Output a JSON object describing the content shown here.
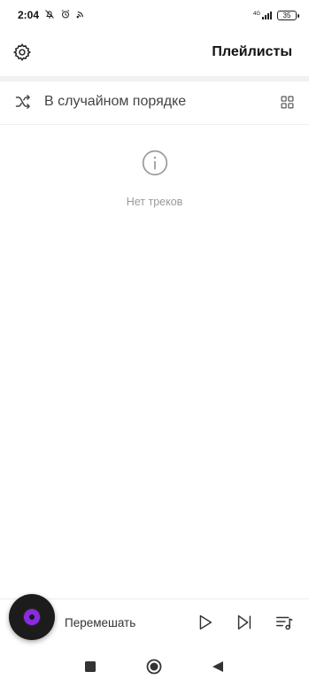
{
  "status_bar": {
    "time": "2:04",
    "network": "4G",
    "battery": "35",
    "icons": [
      "mute-bell-icon",
      "alarm-icon",
      "cast-icon",
      "signal-icon",
      "battery-icon"
    ]
  },
  "header": {
    "title": "Плейлисты",
    "settings_icon": "gear-icon"
  },
  "shuffle_row": {
    "label": "В случайном порядке",
    "shuffle_icon": "shuffle-icon",
    "grid_icon": "grid-view-icon"
  },
  "empty_state": {
    "icon": "info-icon",
    "message": "Нет треков"
  },
  "player": {
    "label": "Перемешать",
    "controls": [
      "play-icon",
      "skip-next-icon",
      "queue-icon"
    ],
    "accent": "#8a2be2"
  },
  "navbar": {
    "buttons": [
      "recents-icon",
      "home-icon",
      "back-icon"
    ]
  }
}
